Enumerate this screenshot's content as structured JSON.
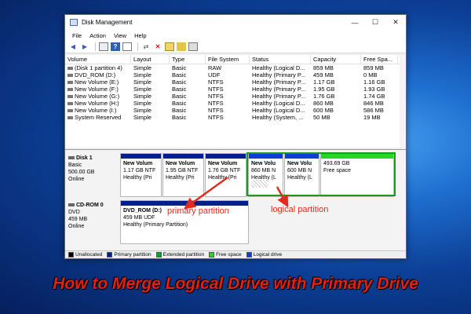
{
  "window": {
    "title": "Disk Management",
    "minimize_glyph": "—",
    "maximize_glyph": "☐",
    "close_glyph": "✕"
  },
  "menu": [
    "File",
    "Action",
    "View",
    "Help"
  ],
  "toolbar_icons": [
    "back-arrow-icon",
    "forward-arrow-icon",
    "console-tree-icon",
    "help-icon",
    "list-view-icon",
    "connect-icon",
    "delete-icon",
    "properties-icon",
    "refresh-icon",
    "settings-icon"
  ],
  "table": {
    "headers": [
      "Volume",
      "Layout",
      "Type",
      "File System",
      "Status",
      "Capacity",
      "Free Spa..."
    ],
    "rows": [
      [
        "(Disk 1 partition 4)",
        "Simple",
        "Basic",
        "RAW",
        "Healthy (Logical D...",
        "859 MB",
        "859 MB"
      ],
      [
        "DVD_ROM (D:)",
        "Simple",
        "Basic",
        "UDF",
        "Healthy (Primary P...",
        "459 MB",
        "0 MB"
      ],
      [
        "New Volume (E:)",
        "Simple",
        "Basic",
        "NTFS",
        "Healthy (Primary P...",
        "1.17 GB",
        "1.16 GB"
      ],
      [
        "New Volume (F:)",
        "Simple",
        "Basic",
        "NTFS",
        "Healthy (Primary P...",
        "1.95 GB",
        "1.93 GB"
      ],
      [
        "New Volume (G:)",
        "Simple",
        "Basic",
        "NTFS",
        "Healthy (Primary P...",
        "1.76 GB",
        "1.74 GB"
      ],
      [
        "New Volume (H:)",
        "Simple",
        "Basic",
        "NTFS",
        "Healthy (Logical D...",
        "860 MB",
        "846 MB"
      ],
      [
        "New Volume (I:)",
        "Simple",
        "Basic",
        "NTFS",
        "Healthy (Logical D...",
        "600 MB",
        "586 MB"
      ],
      [
        "System Reserved",
        "Simple",
        "Basic",
        "NTFS",
        "Healthy (System, ...",
        "50 MB",
        "19 MB"
      ]
    ]
  },
  "disks": [
    {
      "name": "Disk 1",
      "kind": "Basic",
      "size": "500.00 GB",
      "state": "Online",
      "partitions": [
        {
          "name": "New Volum",
          "size": "1.17 GB NTF",
          "status": "Healthy (Pri",
          "band": "primary"
        },
        {
          "name": "New Volum",
          "size": "1.95 GB NTF",
          "status": "Healthy (Pri",
          "band": "primary"
        },
        {
          "name": "New Volum",
          "size": "1.76 GB NTF",
          "status": "Healthy (Pri",
          "band": "primary"
        },
        {
          "name": "New Volu",
          "size": "860 MB N",
          "status": "Healthy (L",
          "band": "logical"
        },
        {
          "name": "New Volu",
          "size": "600 MB N",
          "status": "Healthy (L",
          "band": "logical"
        },
        {
          "name": "",
          "size": "493.69 GB",
          "status": "Free space",
          "band": "free"
        }
      ]
    },
    {
      "name": "CD-ROM 0",
      "kind": "DVD",
      "size": "459 MB",
      "state": "Online",
      "partitions": [
        {
          "name": "DVD_ROM (D:)",
          "size": "459 MB UDF",
          "status": "Healthy (Primary Partition)",
          "band": "primary"
        }
      ]
    }
  ],
  "legend": [
    {
      "label": "Unallocated",
      "color": "#000000"
    },
    {
      "label": "Primary partition",
      "color": "#001f8f"
    },
    {
      "label": "Extended partition",
      "color": "#1b9a24"
    },
    {
      "label": "Free space",
      "color": "#23d723"
    },
    {
      "label": "Logical drive",
      "color": "#0b3fd6"
    }
  ],
  "annotations": {
    "primary": "primary partition",
    "logical": "logical partition",
    "arrow_color": "#e12b1e"
  },
  "banner": "How to Merge Logical Drive with Primary Drive"
}
